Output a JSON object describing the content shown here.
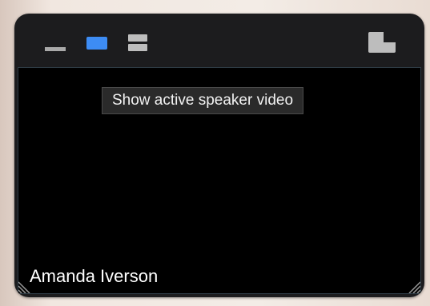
{
  "window": {
    "tooltip": "Show active speaker video",
    "participant_name": "Amanda Iverson"
  },
  "toolbar": {
    "buttons": [
      {
        "icon": "minimize-icon",
        "label": "Minimize video"
      },
      {
        "icon": "speaker-view-icon",
        "label": "Active speaker",
        "selected": true
      },
      {
        "icon": "gallery-view-icon",
        "label": "Gallery view"
      },
      {
        "icon": "exit-minimized-icon",
        "label": "Exit minimized video"
      }
    ]
  },
  "colors": {
    "accent": "#3d8cf4",
    "window_bg": "#1c1c1e",
    "video_bg": "#000000"
  }
}
